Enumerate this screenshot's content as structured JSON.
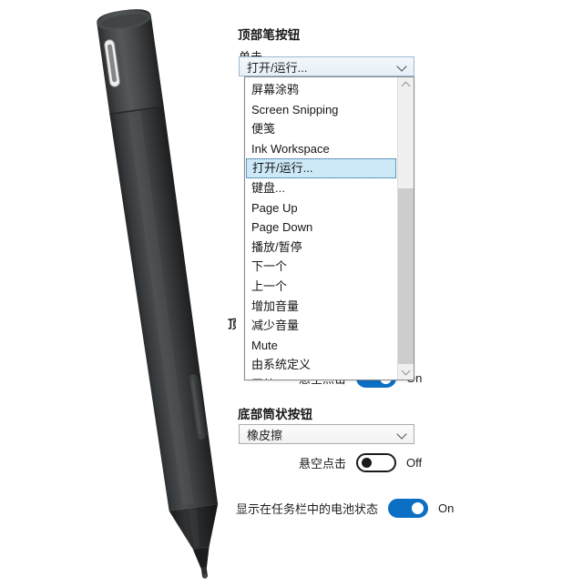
{
  "window": {
    "background_color": "#ffffff",
    "accent_color": "#0b6fc4"
  },
  "illustration": {
    "name": "stylus-pen-photo",
    "description": "Black stylus pen shown diagonally, top-left to bottom-center",
    "body_color": "#3a3c3d",
    "tip_color": "#262829",
    "clip_color": "#f2f2f2"
  },
  "sections": {
    "top_button": {
      "header": "顶部笔按钮",
      "click_label": "单击",
      "combo_value": "打开/运行...",
      "hover_toggle": {
        "label": "悬空点击",
        "state": "On",
        "on": true
      }
    },
    "bottom_button": {
      "header": "底部筒状按钮",
      "combo_value": "橡皮擦",
      "hover_toggle": {
        "label": "悬空点击",
        "state": "Off",
        "on": false
      }
    },
    "battery": {
      "label": "显示在任务栏中的电池状态",
      "state": "On",
      "on": true
    }
  },
  "dropdown": {
    "open": true,
    "selected_index": 4,
    "items": [
      "屏幕涂鸦",
      "Screen Snipping",
      "便笺",
      "Ink Workspace",
      "打开/运行...",
      "键盘...",
      "Page Up",
      "Page Down",
      "播放/暂停",
      "下一个",
      "上一个",
      "增加音量",
      "减少音量",
      "Mute",
      "由系统定义",
      "无效"
    ],
    "scrollbar": {
      "up_icon": "chevron-up-icon",
      "down_icon": "chevron-down-icon"
    }
  },
  "occluded_text": {
    "fragment_n": "n",
    "fragment_ding": "顶"
  }
}
